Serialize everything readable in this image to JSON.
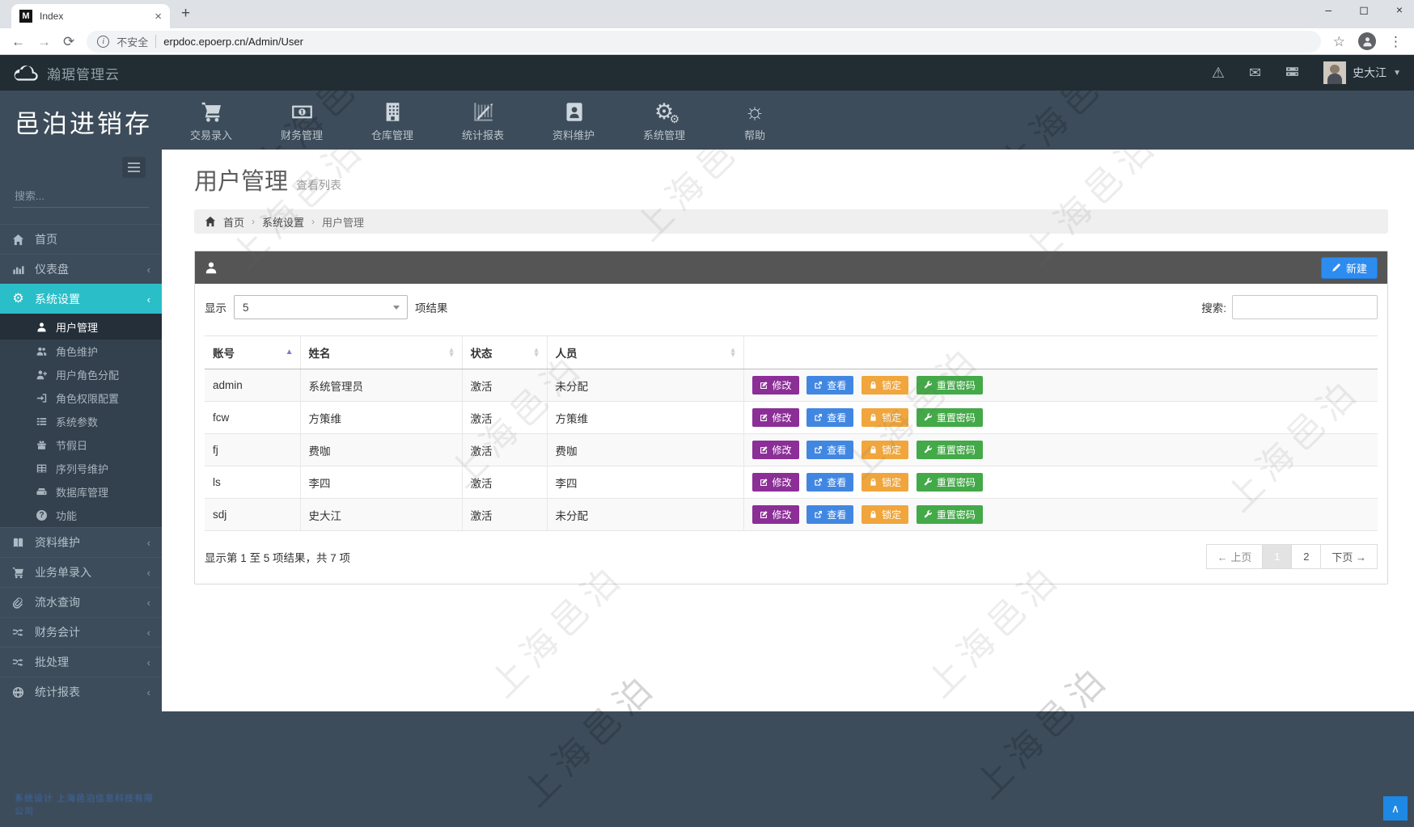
{
  "browser": {
    "tab_title": "Index",
    "favicon_letter": "M",
    "security_label": "不安全",
    "url": "erpdoc.epoerp.cn/Admin/User"
  },
  "navbar": {
    "app_title": "瀚琚管理云",
    "user_name": "史大江"
  },
  "header": {
    "brand": "邑泊进销存",
    "menu": [
      {
        "label": "交易录入",
        "icon": "cart-icon"
      },
      {
        "label": "财务管理",
        "icon": "money-icon"
      },
      {
        "label": "仓库管理",
        "icon": "warehouse-icon"
      },
      {
        "label": "统计报表",
        "icon": "stats-icon"
      },
      {
        "label": "资料维护",
        "icon": "contact-card-icon"
      },
      {
        "label": "系统管理",
        "icon": "gears-icon"
      },
      {
        "label": "帮助",
        "icon": "help-sun-icon"
      }
    ]
  },
  "sidebar": {
    "search_placeholder": "搜索...",
    "items": [
      {
        "label": "首页",
        "icon": "home-icon"
      },
      {
        "label": "仪表盘",
        "icon": "dashboard-icon"
      },
      {
        "label": "系统设置",
        "icon": "gears-icon",
        "active": true
      },
      {
        "label": "资料维护",
        "icon": "book-icon"
      },
      {
        "label": "业务单录入",
        "icon": "cart-icon"
      },
      {
        "label": "流水查询",
        "icon": "paperclip-icon"
      },
      {
        "label": "财务会计",
        "icon": "shuffle-icon"
      },
      {
        "label": "批处理",
        "icon": "shuffle-icon"
      },
      {
        "label": "统计报表",
        "icon": "globe-icon"
      }
    ],
    "submenu": [
      {
        "label": "用户管理",
        "icon": "user-icon",
        "active": true
      },
      {
        "label": "角色维护",
        "icon": "users-icon"
      },
      {
        "label": "用户角色分配",
        "icon": "user-plus-icon"
      },
      {
        "label": "角色权限配置",
        "icon": "sign-in-icon"
      },
      {
        "label": "系统参数",
        "icon": "list-icon"
      },
      {
        "label": "节假日",
        "icon": "gift-icon"
      },
      {
        "label": "序列号维护",
        "icon": "table-icon"
      },
      {
        "label": "数据库管理",
        "icon": "database-icon"
      },
      {
        "label": "功能",
        "icon": "question-icon"
      }
    ],
    "footer": "系统设计 上海邑泊信息科技有限公司"
  },
  "page": {
    "title": "用户管理",
    "subtitle": "查看列表",
    "breadcrumb": [
      "首页",
      "系统设置",
      "用户管理"
    ]
  },
  "panel": {
    "new_button": "新建",
    "length_before": "显示",
    "length_value": "5",
    "length_after": "项结果",
    "search_label": "搜索:",
    "table": {
      "columns": [
        "账号",
        "姓名",
        "状态",
        "人员"
      ],
      "rows": [
        {
          "account": "admin",
          "name": "系统管理员",
          "status": "激活",
          "person": "未分配"
        },
        {
          "account": "fcw",
          "name": "方策维",
          "status": "激活",
          "person": "方策维"
        },
        {
          "account": "fj",
          "name": "费咖",
          "status": "激活",
          "person": "费咖"
        },
        {
          "account": "ls",
          "name": "李四",
          "status": "激活",
          "person": "李四"
        },
        {
          "account": "sdj",
          "name": "史大江",
          "status": "激活",
          "person": "未分配"
        }
      ],
      "actions": {
        "edit": "修改",
        "view": "查看",
        "lock": "锁定",
        "reset": "重置密码"
      }
    },
    "info": "显示第 1 至 5 项结果，共 7 项",
    "pagination": {
      "prev": "← 上页",
      "p1": "1",
      "p2": "2",
      "next": "下页 →"
    }
  },
  "watermark": "上海邑泊",
  "colors": {
    "accent_teal": "#29bec8",
    "primary_blue": "#2d8cf0",
    "edit_purple": "#8b2f97",
    "view_blue": "#4187e2",
    "lock_orange": "#f0a63c",
    "reset_green": "#44a948"
  }
}
